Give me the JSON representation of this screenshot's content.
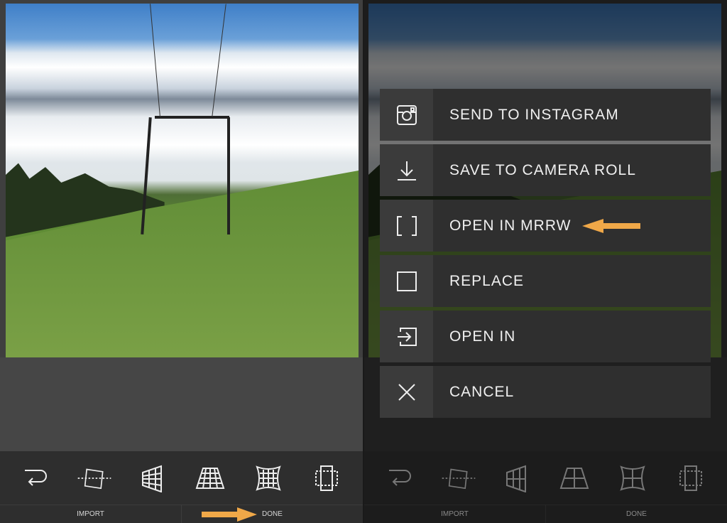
{
  "left_panel": {
    "toolbar_icons": [
      "undo-icon",
      "straighten-icon",
      "vertical-perspective-icon",
      "horizontal-perspective-icon",
      "distortion-icon",
      "crop-ratio-icon"
    ],
    "import_label": "IMPORT",
    "done_label": "DONE"
  },
  "right_panel": {
    "menu": [
      {
        "label": "SEND TO INSTAGRAM",
        "icon": "instagram-icon"
      },
      {
        "label": "SAVE TO CAMERA ROLL",
        "icon": "download-icon"
      },
      {
        "label": "OPEN IN MRRW",
        "icon": "brackets-icon"
      },
      {
        "label": "REPLACE",
        "icon": "square-icon"
      },
      {
        "label": "OPEN IN",
        "icon": "open-in-icon"
      },
      {
        "label": "CANCEL",
        "icon": "close-icon"
      }
    ],
    "import_label": "IMPORT",
    "done_label": "DONE"
  },
  "colors": {
    "highlight_arrow": "#f0a848",
    "menu_bg": "#2f2f2f",
    "toolbar_bg": "#2e2e2e"
  }
}
